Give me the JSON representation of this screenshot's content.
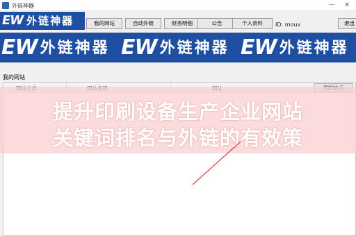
{
  "window": {
    "title": "外链神器"
  },
  "logo": {
    "mark": "EW",
    "text": "外链神器"
  },
  "toolbar": {
    "buttons": [
      {
        "label": "我的网站"
      },
      {
        "label": "自动外链"
      },
      {
        "label": "财务明细"
      },
      {
        "label": "公告"
      },
      {
        "label": "个人资料"
      }
    ],
    "user_id": "ID: mouv",
    "exit_label": "退出"
  },
  "banner": {
    "mark": "EW",
    "text": "外链神器"
  },
  "section": {
    "title": "我的网站"
  },
  "table": {
    "columns": [
      "网站分类",
      "网站名称",
      "网址"
    ],
    "add_button": "添加站点"
  },
  "overlay": {
    "line1": "提升印刷设备生产企业网站",
    "line2": "关键词排名与外链的有效策"
  },
  "colors": {
    "brand_blue": "#1f4fa3",
    "overlay_pink": "#facdcd",
    "pointer_red": "#e04040"
  }
}
